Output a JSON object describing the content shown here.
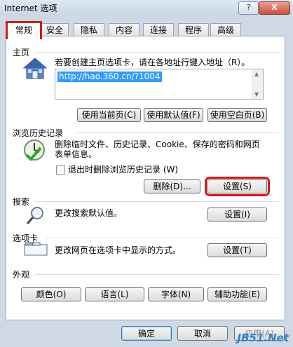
{
  "window": {
    "title": "Internet 选项",
    "help_label": "?",
    "close_label": "X"
  },
  "tabs": [
    "常规",
    "安全",
    "隐私",
    "内容",
    "连接",
    "程序",
    "高级"
  ],
  "home": {
    "section_title": "主页",
    "description": "若要创建主页选项卡，请在各地址行键入地址（R）。",
    "url": "http://hao.360.cn/?1004",
    "buttons": [
      "使用当前页(C)",
      "使用默认值(F)",
      "使用空白页(B)"
    ]
  },
  "history": {
    "section_title": "浏览历史记录",
    "description_line1": "删除临时文件、历史记录、Cookie、保存的密码和网页",
    "description_line2": "表单信息。",
    "checkbox_label": "退出时删除浏览历史记录 (W)",
    "delete_button": "删除(D)...",
    "settings_button": "设置(S)"
  },
  "search": {
    "section_title": "搜索",
    "description": "更改搜索默认值。",
    "settings_button": "设置(I)"
  },
  "tabsec": {
    "section_title": "选项卡",
    "description": "更改网页在选项卡中显示的方式。",
    "settings_button": "设置(T)"
  },
  "appearance": {
    "section_title": "外观",
    "buttons": [
      "颜色(O)",
      "语言(L)",
      "字体(N)",
      "辅助功能(E)"
    ]
  },
  "footer": {
    "ok": "确定",
    "cancel": "取消",
    "apply": "应用(A)"
  },
  "watermark": "JB51.Net",
  "colors": {
    "highlight": "#d11a1a",
    "selection": "#3399ff"
  }
}
